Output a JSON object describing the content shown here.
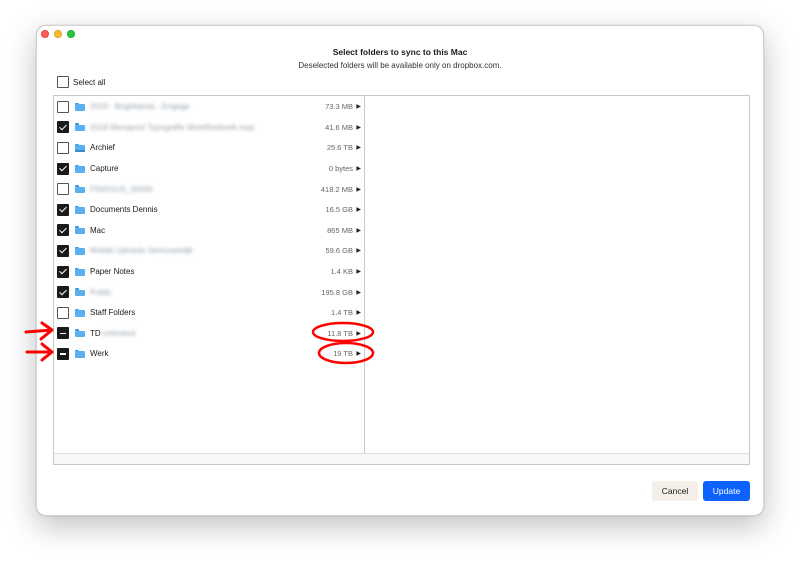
{
  "dialog": {
    "title": "Select folders to sync to this Mac",
    "subtitle": "Deselected folders will be available only on dropbox.com.",
    "select_all_label": "Select all"
  },
  "folders": [
    {
      "name": "2019 - Brightlands - Engage",
      "size": "73.3 MB",
      "state": "unchecked",
      "blurred": true
    },
    {
      "name": "2018 Menapool Typografie Workflowboek map",
      "size": "41.6 MB",
      "state": "checked",
      "blurred": true
    },
    {
      "name": "Archief",
      "size": "25.6 TB",
      "state": "unchecked",
      "blurred": false,
      "shared": true
    },
    {
      "name": "Capture",
      "size": "0 bytes",
      "state": "checked",
      "blurred": false
    },
    {
      "name": "FINDOUS_00000",
      "size": "418.2 MB",
      "state": "unchecked",
      "blurred": true
    },
    {
      "name": "Documents Dennis",
      "size": "16.5 GB",
      "state": "checked",
      "blurred": false
    },
    {
      "name": "Mac",
      "size": "865 MB",
      "state": "checked",
      "blurred": false
    },
    {
      "name": "Mobile Uploads Vertrouwelijk",
      "size": "59.6 GB",
      "state": "checked",
      "blurred": true
    },
    {
      "name": "Paper Notes",
      "size": "1.4 KB",
      "state": "checked",
      "blurred": false
    },
    {
      "name": "Public",
      "size": "195.8 GB",
      "state": "checked",
      "blurred": true
    },
    {
      "name": "Staff Folders",
      "size": "1.4 TB",
      "state": "unchecked",
      "blurred": false
    },
    {
      "name": "TD",
      "name_hidden": "Unlimited",
      "size": "11.8 TB",
      "state": "mixed",
      "blurred": false
    },
    {
      "name": "Werk",
      "size": "19 TB",
      "state": "mixed",
      "blurred": false
    }
  ],
  "buttons": {
    "cancel": "Cancel",
    "update": "Update"
  },
  "icons": {
    "folder": "folder-icon",
    "chevron": "chevron-right-icon"
  },
  "colors": {
    "accent": "#0c62ff",
    "folder": "#5ab0ef",
    "annotation": "#ff0000"
  }
}
